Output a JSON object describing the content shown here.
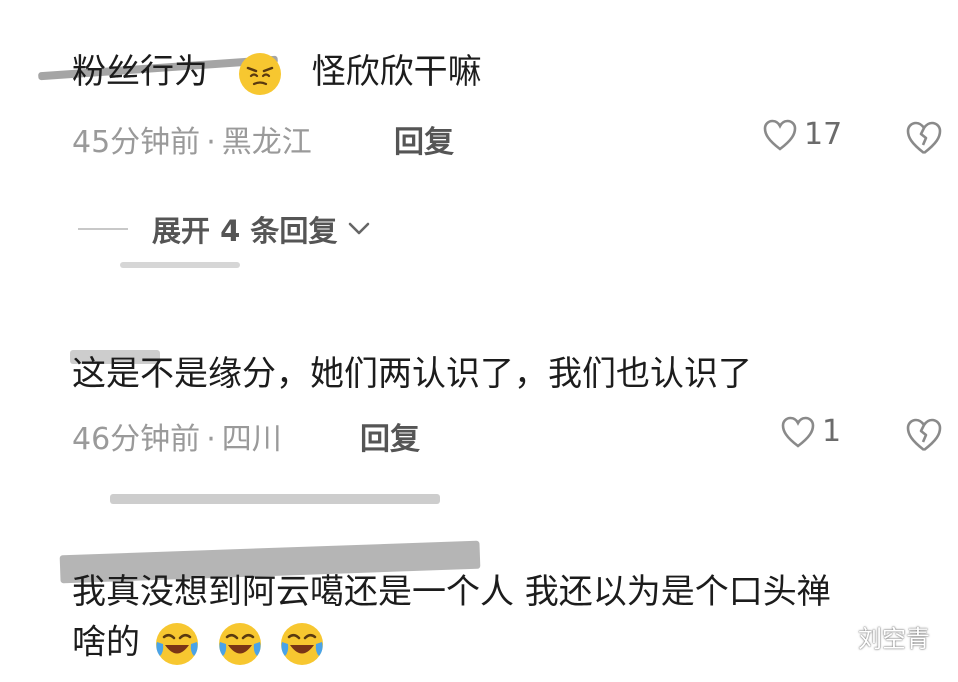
{
  "comments": [
    {
      "text_before_emoji": "粉丝行为",
      "text_after_emoji": "怪欣欣干嘛",
      "emoji": "awkward-face-icon",
      "time": "45分钟前",
      "separator": "·",
      "location": "黑龙江",
      "reply_label": "回复",
      "likes": "17",
      "expand_replies_label": "展开 4 条回复"
    },
    {
      "text": "这是不是缘分，她们两认识了，我们也认识了",
      "time": "46分钟前",
      "separator": "·",
      "location": "四川",
      "reply_label": "回复",
      "likes": "1"
    },
    {
      "text_line1": "我真没想到阿云噶还是一个人 我还以为是个口头禅",
      "text_line2": "啥的",
      "emoji": "laughing-crying-face-icon"
    }
  ],
  "watermark": {
    "label": "刘空青",
    "icon": "wechat-icon"
  },
  "colors": {
    "text": "#1c1c1c",
    "meta": "#9a9a9a",
    "emoji_face": "#f7c730"
  }
}
